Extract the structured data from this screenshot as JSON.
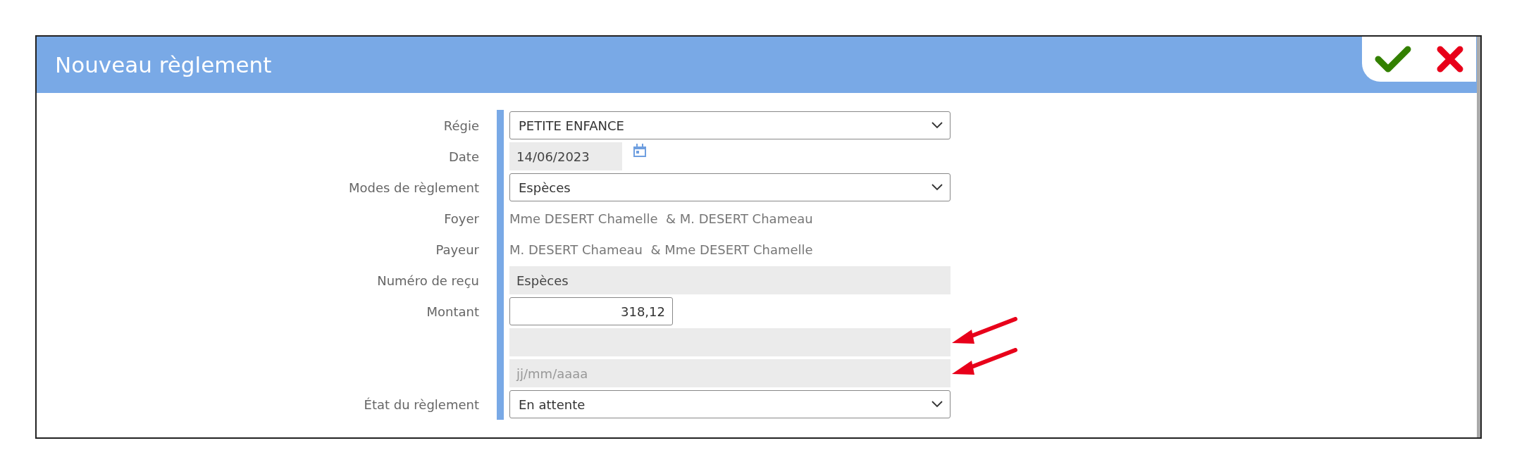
{
  "dialog": {
    "title": "Nouveau règlement"
  },
  "fields": [
    {
      "label": "Régie",
      "kind": "select",
      "value": "PETITE ENFANCE",
      "marked": false
    },
    {
      "label": "Date",
      "kind": "date",
      "value": "14/06/2023",
      "marked": false
    },
    {
      "label": "Modes de règlement",
      "kind": "select",
      "value": "Espèces",
      "marked": false
    },
    {
      "label": "Foyer",
      "kind": "static",
      "value": "Mme DESERT Chamelle  & M. DESERT Chameau",
      "marked": false
    },
    {
      "label": "Payeur",
      "kind": "static",
      "value": "M. DESERT Chameau  & Mme DESERT Chamelle",
      "marked": false
    },
    {
      "label": "Numéro de reçu",
      "kind": "readonly",
      "value": "Espèces",
      "marked": false
    },
    {
      "label": "Montant",
      "kind": "amount",
      "value": "318,12",
      "marked": false
    },
    {
      "kind": "readonly",
      "marked": true
    },
    {
      "kind": "readonly",
      "placeholder": "jj/mm/aaaa",
      "marked": true
    },
    {
      "label": "État du règlement",
      "kind": "select",
      "value": "En attente",
      "marked": false
    }
  ]
}
